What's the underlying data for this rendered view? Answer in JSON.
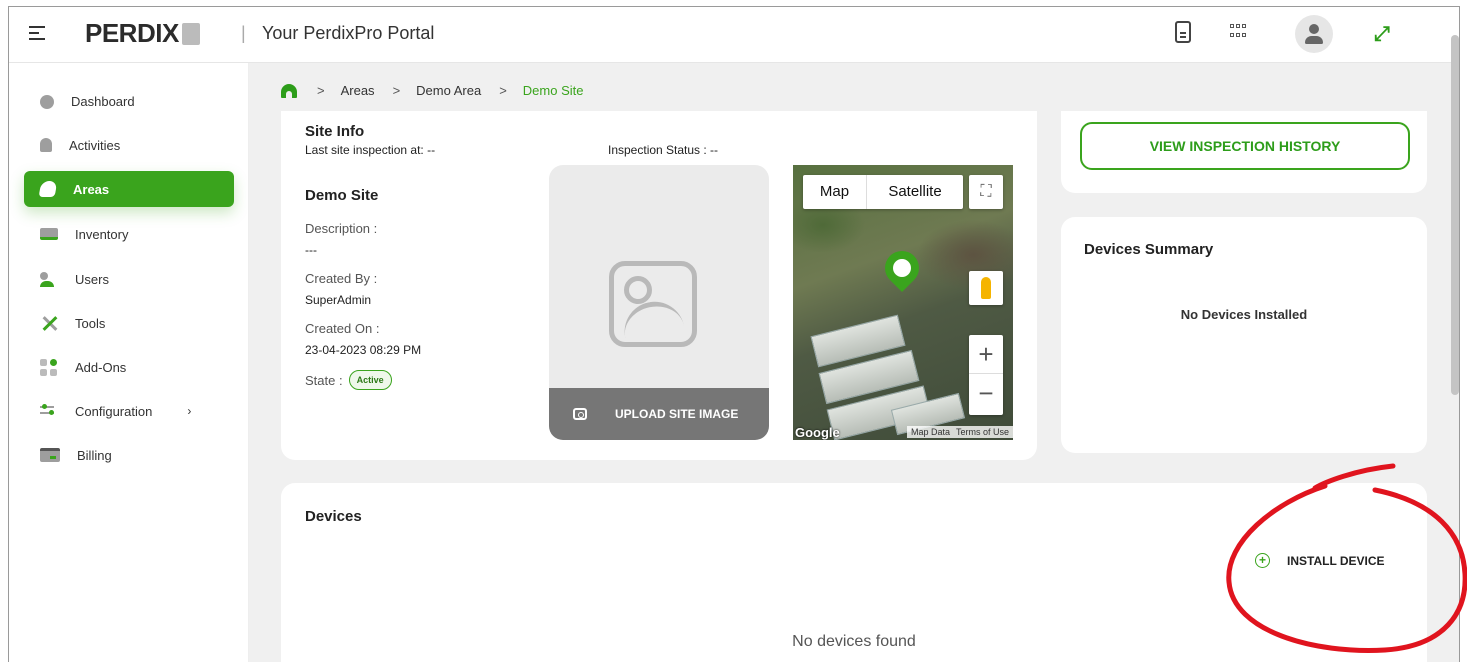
{
  "header": {
    "logo": "PERDIX",
    "portal_title": "Your PerdixPro Portal",
    "separator": "|"
  },
  "sidebar": {
    "items": [
      {
        "label": "Dashboard"
      },
      {
        "label": "Activities"
      },
      {
        "label": "Areas"
      },
      {
        "label": "Inventory"
      },
      {
        "label": "Users"
      },
      {
        "label": "Tools"
      },
      {
        "label": "Add-Ons"
      },
      {
        "label": "Configuration"
      },
      {
        "label": "Billing"
      }
    ],
    "active": "Areas"
  },
  "breadcrumb": {
    "items": [
      "Areas",
      "Demo Area"
    ],
    "current": "Demo Site",
    "separator": ">"
  },
  "site_info": {
    "title": "Site Info",
    "last_inspection": "Last site inspection at: --",
    "inspection_status": "Inspection Status : --",
    "site_name": "Demo Site",
    "description_label": "Description :",
    "description_value": "---",
    "created_by_label": "Created By :",
    "created_by_value": "SuperAdmin",
    "created_on_label": "Created On :",
    "created_on_value": "23-04-2023 08:29 PM",
    "state_label": "State :",
    "state_value": "Active",
    "upload_label": "UPLOAD SITE IMAGE"
  },
  "map": {
    "map_tab": "Map",
    "satellite_tab": "Satellite",
    "zoom_in": "+",
    "zoom_out": "−",
    "google": "Google",
    "map_data": "Map Data",
    "terms": "Terms of Use"
  },
  "inspection_history_button": "VIEW INSPECTION HISTORY",
  "devices_summary": {
    "title": "Devices Summary",
    "empty_text": "No Devices Installed"
  },
  "devices": {
    "title": "Devices",
    "install_label": "INSTALL DEVICE",
    "empty_text": "No devices found"
  },
  "colors": {
    "accent": "#3aa41d",
    "annotation": "#e0141e"
  }
}
